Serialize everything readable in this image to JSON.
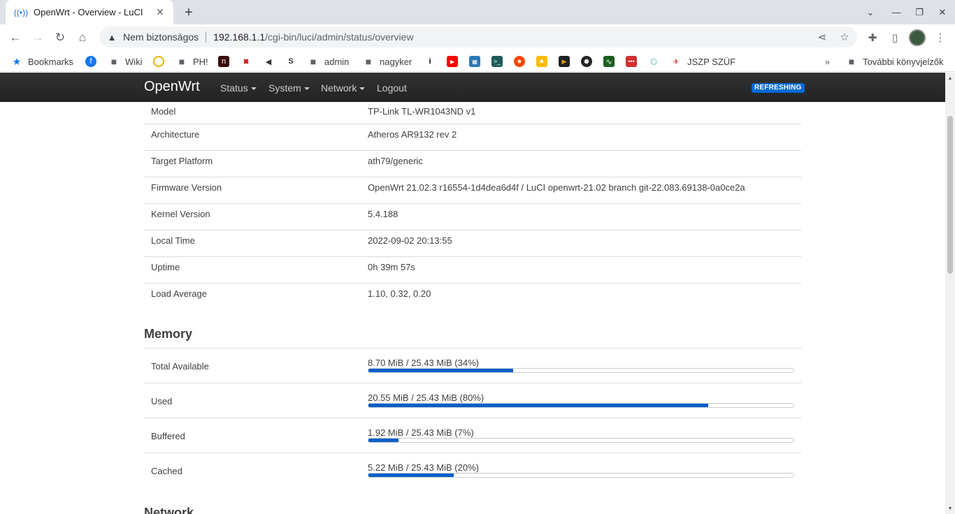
{
  "browser": {
    "tab_title": "OpenWrt - Overview - LuCI",
    "security_text": "Nem biztonságos",
    "url_host": "192.168.1.1",
    "url_path": "/cgi-bin/luci/admin/status/overview",
    "bookmarks": [
      {
        "label": "Bookmarks",
        "icon": "star-icon"
      },
      {
        "label": "",
        "icon": "facebook-icon"
      },
      {
        "label": "Wiki",
        "icon": "folder-icon"
      },
      {
        "label": "",
        "icon": "chat-icon"
      },
      {
        "label": "PH!",
        "icon": "folder-icon"
      },
      {
        "label": "",
        "icon": "n-icon"
      },
      {
        "label": "",
        "icon": "camera-icon"
      },
      {
        "label": "",
        "icon": "megaphone-icon"
      },
      {
        "label": "",
        "icon": "s-icon"
      },
      {
        "label": "admin",
        "icon": "folder-icon"
      },
      {
        "label": "nagyker",
        "icon": "folder-icon"
      },
      {
        "label": "",
        "icon": "i-icon"
      },
      {
        "label": "",
        "icon": "youtube-icon"
      },
      {
        "label": "",
        "icon": "grid-icon"
      },
      {
        "label": "",
        "icon": "terminal-icon"
      },
      {
        "label": "",
        "icon": "reddit-icon"
      },
      {
        "label": "",
        "icon": "bulb-icon"
      },
      {
        "label": "",
        "icon": "plex-icon"
      },
      {
        "label": "",
        "icon": "game-icon"
      },
      {
        "label": "",
        "icon": "pulse-icon"
      },
      {
        "label": "",
        "icon": "dots-icon"
      },
      {
        "label": "",
        "icon": "hex-icon"
      },
      {
        "label": "JSZP SZÜF",
        "icon": "figure-icon"
      }
    ],
    "other_bookmarks": "További könyvjelzők",
    "more_chevron": "»"
  },
  "header": {
    "brand": "OpenWrt",
    "menus": [
      "Status",
      "System",
      "Network",
      "Logout"
    ],
    "badge": "REFRESHING"
  },
  "system": [
    {
      "key": "Model",
      "value": "TP-Link TL-WR1043ND v1"
    },
    {
      "key": "Architecture",
      "value": "Atheros AR9132 rev 2"
    },
    {
      "key": "Target Platform",
      "value": "ath79/generic"
    },
    {
      "key": "Firmware Version",
      "value": "OpenWrt 21.02.3 r16554-1d4dea6d4f / LuCI openwrt-21.02 branch git-22.083.69138-0a0ce2a"
    },
    {
      "key": "Kernel Version",
      "value": "5.4.188"
    },
    {
      "key": "Local Time",
      "value": "2022-09-02 20:13:55"
    },
    {
      "key": "Uptime",
      "value": "0h 39m 57s"
    },
    {
      "key": "Load Average",
      "value": "1.10, 0.32, 0.20"
    }
  ],
  "memory": {
    "title": "Memory",
    "rows": [
      {
        "key": "Total Available",
        "text": "8.70 MiB / 25.43 MiB (34%)",
        "fraction": 0.34
      },
      {
        "key": "Used",
        "text": "20.55 MiB / 25.43 MiB (80%)",
        "fraction": 0.8
      },
      {
        "key": "Buffered",
        "text": "1.92 MiB / 25.43 MiB (7%)",
        "fraction": 0.07
      },
      {
        "key": "Cached",
        "text": "5.22 MiB / 25.43 MiB (20%)",
        "fraction": 0.2
      }
    ]
  },
  "network": {
    "title": "Network"
  },
  "colors": {
    "accent": "#0a5fc9",
    "header_bg": "#222222",
    "badge": "#0069d6"
  }
}
